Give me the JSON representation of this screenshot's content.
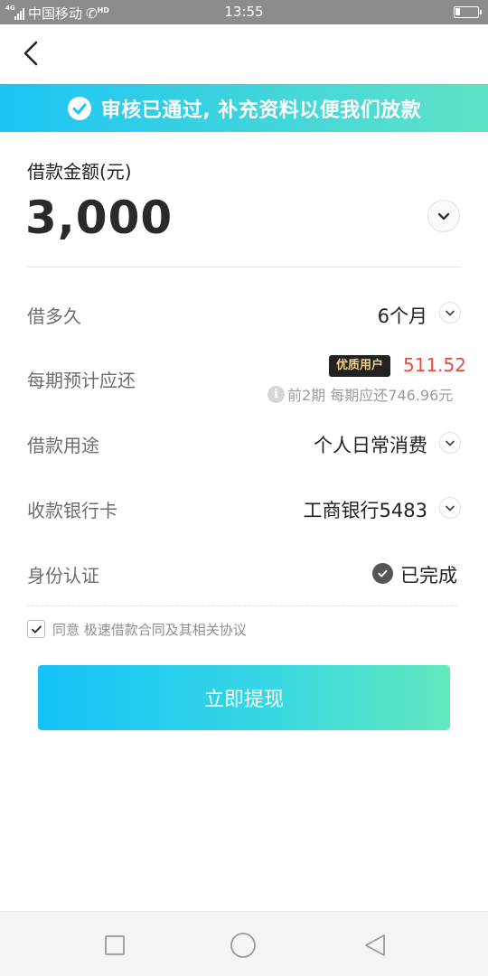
{
  "status_bar": {
    "network": "4G",
    "carrier": "中国移动",
    "hd": "HD",
    "time": "13:55"
  },
  "banner": {
    "text": "审核已通过, 补充资料以便我们放款",
    "icon": "check-circle-icon"
  },
  "amount": {
    "label": "借款金额(元)",
    "value": "3,000"
  },
  "rows": {
    "term": {
      "label": "借多久",
      "value": "6个月"
    },
    "repayment": {
      "label": "每期预计应还",
      "badge": "优质用户",
      "amount": "511.52",
      "note": "前2期 每期应还746.96元"
    },
    "purpose": {
      "label": "借款用途",
      "value": "个人日常消费"
    },
    "bank_card": {
      "label": "收款银行卡",
      "value": "工商银行5483"
    },
    "identity": {
      "label": "身份认证",
      "value": "已完成"
    }
  },
  "agreement": {
    "prefix": "同意",
    "link": "极速借款合同及其相关协议",
    "checked": true
  },
  "withdraw_button": "立即提现",
  "colors": {
    "accent_start": "#14c2f7",
    "accent_end": "#62e9bd",
    "price_red": "#e84e3d",
    "badge_bg": "#222222",
    "badge_text": "#f2d28a"
  }
}
